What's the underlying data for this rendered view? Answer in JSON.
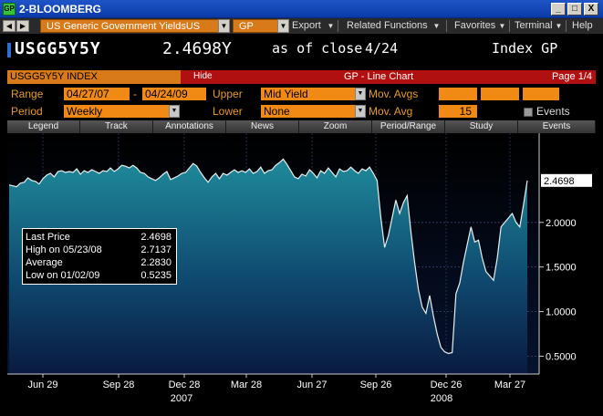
{
  "window": {
    "title": "2-BLOOMBERG",
    "icon": "GP",
    "buttons": [
      "_",
      "□",
      "X"
    ]
  },
  "toolbar": {
    "security": "US Generic Government YieldsUS",
    "function": "GP",
    "menus": [
      "Export",
      "Related Functions",
      "Favorites",
      "Terminal",
      "Help"
    ]
  },
  "header": {
    "ticker": "USGG5Y5Y",
    "price": "2.4698Y",
    "as_of": "as of close",
    "date": "4/24",
    "index_label": "Index GP"
  },
  "security_bar": {
    "security": "USGG5Y5Y INDEX",
    "hide": "Hide",
    "chart_title": "GP - Line Chart",
    "page": "Page 1/4"
  },
  "settings": {
    "range_label": "Range",
    "range_start": "04/27/07",
    "range_dash": "-",
    "range_end": "04/24/09",
    "upper_label": "Upper",
    "upper_value": "Mid Yield",
    "mov_avgs_label": "Mov. Avgs",
    "period_label": "Period",
    "period_value": "Weekly",
    "lower_label": "Lower",
    "lower_value": "None",
    "mov_avg_label": "Mov. Avg",
    "mov_avg_value": "15",
    "events_label": "Events"
  },
  "tabs": [
    "Legend",
    "Track",
    "Annotations",
    "News",
    "Zoom",
    "Period/Range",
    "Study",
    "Events"
  ],
  "legend": {
    "rows": [
      {
        "key": "Last Price",
        "value": "2.4698"
      },
      {
        "key": "High on  05/23/08",
        "value": "2.7137"
      },
      {
        "key": "Average",
        "value": "2.2830"
      },
      {
        "key": "Low on  01/02/09",
        "value": "0.5235"
      }
    ]
  },
  "colors": {
    "titlebar": "#1f55c7",
    "orange": "#f08a14",
    "red_bar": "#b01010",
    "fill_top": "#1f8a9a",
    "fill_bottom": "#0a1a40"
  },
  "chart_data": {
    "type": "area",
    "title": "GP - Line Chart",
    "xlabel": "",
    "ylabel": "",
    "ylim": [
      0.3,
      3.0
    ],
    "last_value_label": "2.4698",
    "y_ticks": [
      0.5,
      1.0,
      1.5,
      2.0
    ],
    "y_tick_labels": [
      "0.5000",
      "1.0000",
      "1.5000",
      "2.0000"
    ],
    "x_tick_labels": [
      "Jun 29",
      "Sep 28",
      "Dec 28",
      "Mar 28",
      "Jun 27",
      "Sep 26",
      "Dec 26",
      "Mar 27"
    ],
    "year_labels": [
      "2007",
      "2008"
    ],
    "grid": true,
    "values": [
      2.42,
      2.41,
      2.4,
      2.44,
      2.45,
      2.5,
      2.47,
      2.46,
      2.43,
      2.49,
      2.53,
      2.55,
      2.51,
      2.57,
      2.58,
      2.56,
      2.57,
      2.56,
      2.6,
      2.54,
      2.58,
      2.56,
      2.59,
      2.57,
      2.55,
      2.58,
      2.57,
      2.61,
      2.57,
      2.6,
      2.64,
      2.63,
      2.61,
      2.64,
      2.61,
      2.56,
      2.55,
      2.51,
      2.49,
      2.47,
      2.5,
      2.54,
      2.57,
      2.48,
      2.5,
      2.52,
      2.55,
      2.56,
      2.61,
      2.66,
      2.63,
      2.56,
      2.5,
      2.45,
      2.51,
      2.55,
      2.49,
      2.55,
      2.53,
      2.56,
      2.59,
      2.56,
      2.58,
      2.56,
      2.6,
      2.55,
      2.57,
      2.62,
      2.55,
      2.58,
      2.59,
      2.64,
      2.67,
      2.71,
      2.65,
      2.58,
      2.51,
      2.49,
      2.54,
      2.52,
      2.59,
      2.55,
      2.5,
      2.58,
      2.55,
      2.61,
      2.56,
      2.51,
      2.6,
      2.57,
      2.58,
      2.62,
      2.58,
      2.55,
      2.6,
      2.58,
      2.62,
      2.55,
      2.47,
      2.05,
      1.72,
      1.85,
      2.05,
      2.25,
      2.1,
      2.22,
      2.3,
      1.9,
      1.55,
      1.25,
      1.05,
      0.98,
      1.18,
      0.95,
      0.75,
      0.6,
      0.55,
      0.53,
      0.54,
      1.2,
      1.32,
      1.55,
      1.75,
      1.95,
      1.78,
      1.8,
      1.6,
      1.45,
      1.4,
      1.35,
      1.6,
      1.95,
      2.0,
      2.05,
      2.1,
      2.0,
      1.95,
      2.2,
      2.47
    ]
  }
}
